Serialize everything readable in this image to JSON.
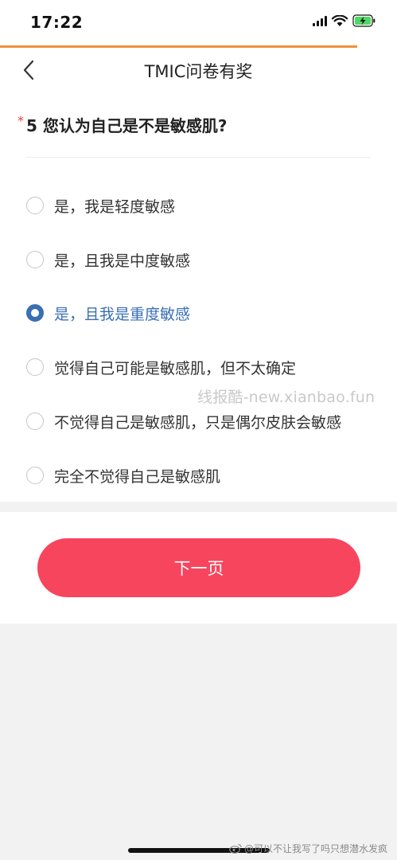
{
  "status_bar": {
    "time": "17:22",
    "icons": [
      "signal-icon",
      "wifi-icon",
      "battery-charging-icon"
    ],
    "battery_color": "#4cd964"
  },
  "survey_progress": 0.9,
  "nav": {
    "back_icon": "chevron-left-icon",
    "title": "TMIC问卷有奖"
  },
  "question": {
    "required_mark": "*",
    "text": "5 您认为自己是不是敏感肌?",
    "options": [
      {
        "label": "是，我是轻度敏感",
        "selected": false
      },
      {
        "label": "是，且我是中度敏感",
        "selected": false
      },
      {
        "label": "是，且我是重度敏感",
        "selected": true
      },
      {
        "label": "觉得自己可能是敏感肌，但不太确定",
        "selected": false
      },
      {
        "label": "不觉得自己是敏感肌，只是偶尔皮肤会敏感",
        "selected": false
      },
      {
        "label": "完全不觉得自己是敏感肌",
        "selected": false
      }
    ]
  },
  "watermark": "线报酷-new.xianbao.fun",
  "footer": {
    "next_label": "下一页"
  },
  "credit": "@可以不让我写了吗只想潜水发疯",
  "colors": {
    "accent": "#f7455e",
    "selected": "#3a6fb3",
    "progress": "#f0903a",
    "required": "#e8463e"
  }
}
